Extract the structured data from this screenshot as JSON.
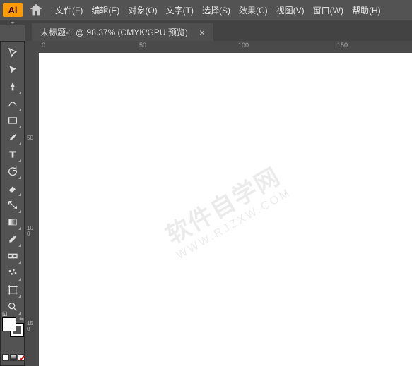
{
  "logo": "Ai",
  "menu": {
    "file": "文件(F)",
    "edit": "编辑(E)",
    "object": "对象(O)",
    "type": "文字(T)",
    "select": "选择(S)",
    "effect": "效果(C)",
    "view": "视图(V)",
    "window": "窗口(W)",
    "help": "帮助(H)"
  },
  "expand_handle": "▸▸",
  "tab": {
    "title": "未标题-1 @ 98.37% (CMYK/GPU 预览)",
    "close": "×"
  },
  "ruler": {
    "h": [
      "0",
      "50",
      "100",
      "150"
    ],
    "v": [
      "50",
      "100",
      "150"
    ]
  },
  "watermark": {
    "main": "软件自学网",
    "sub": "WWW.RJZXW.COM"
  },
  "colors": {
    "fill": "#ffffff",
    "stroke": "#000000",
    "mode_solid": "#ffffff",
    "mode_gradient": "linear-gradient(#fff,#000)",
    "mode_none": "#ff0000"
  }
}
